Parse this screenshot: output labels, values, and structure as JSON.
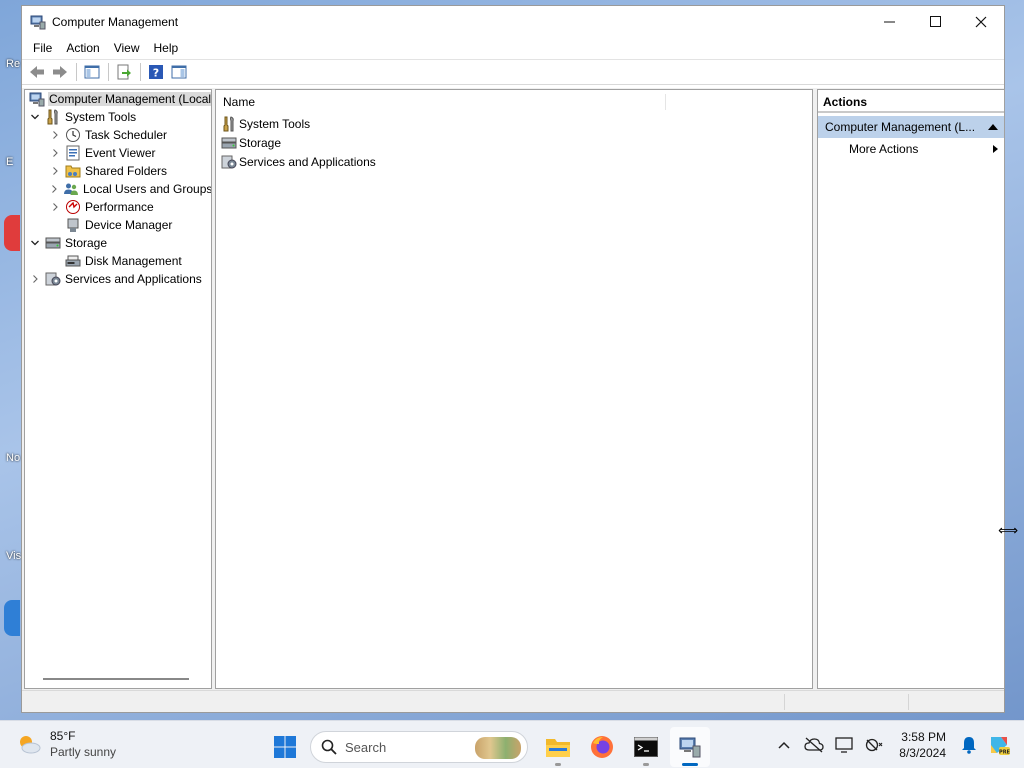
{
  "window": {
    "title": "Computer Management"
  },
  "menu": [
    "File",
    "Action",
    "View",
    "Help"
  ],
  "toolbar": [
    "back-icon",
    "forward-icon",
    "show-hide-console-tree-icon",
    "export-list-icon",
    "help-icon",
    "show-hide-action-pane-icon"
  ],
  "tree": {
    "items": [
      {
        "label": "Computer Management (Local",
        "level": 0,
        "expander": "",
        "icon": "computer-management-icon",
        "selected": true
      },
      {
        "label": "System Tools",
        "level": 1,
        "expander": "expanded",
        "icon": "system-tools-icon"
      },
      {
        "label": "Task Scheduler",
        "level": 2,
        "expander": "collapsed",
        "icon": "task-scheduler-icon"
      },
      {
        "label": "Event Viewer",
        "level": 2,
        "expander": "collapsed",
        "icon": "event-viewer-icon"
      },
      {
        "label": "Shared Folders",
        "level": 2,
        "expander": "collapsed",
        "icon": "shared-folders-icon"
      },
      {
        "label": "Local Users and Groups",
        "level": 2,
        "expander": "collapsed",
        "icon": "local-users-icon"
      },
      {
        "label": "Performance",
        "level": 2,
        "expander": "collapsed",
        "icon": "performance-icon"
      },
      {
        "label": "Device Manager",
        "level": 2,
        "expander": "",
        "icon": "device-manager-icon"
      },
      {
        "label": "Storage",
        "level": 1,
        "expander": "expanded",
        "icon": "storage-icon"
      },
      {
        "label": "Disk Management",
        "level": 2,
        "expander": "",
        "icon": "disk-management-icon"
      },
      {
        "label": "Services and Applications",
        "level": 1,
        "expander": "collapsed",
        "icon": "services-apps-icon"
      }
    ]
  },
  "list": {
    "column": "Name",
    "rows": [
      {
        "label": "System Tools",
        "icon": "system-tools-icon"
      },
      {
        "label": "Storage",
        "icon": "storage-icon"
      },
      {
        "label": "Services and Applications",
        "icon": "services-apps-icon"
      }
    ]
  },
  "actions": {
    "header": "Actions",
    "section": "Computer Management (L...",
    "items": [
      "More Actions"
    ]
  },
  "taskbar": {
    "temperature": "85°F",
    "condition": "Partly sunny",
    "search_placeholder": "Search",
    "time": "3:58 PM",
    "date": "8/3/2024",
    "accent": "#0067c0"
  }
}
